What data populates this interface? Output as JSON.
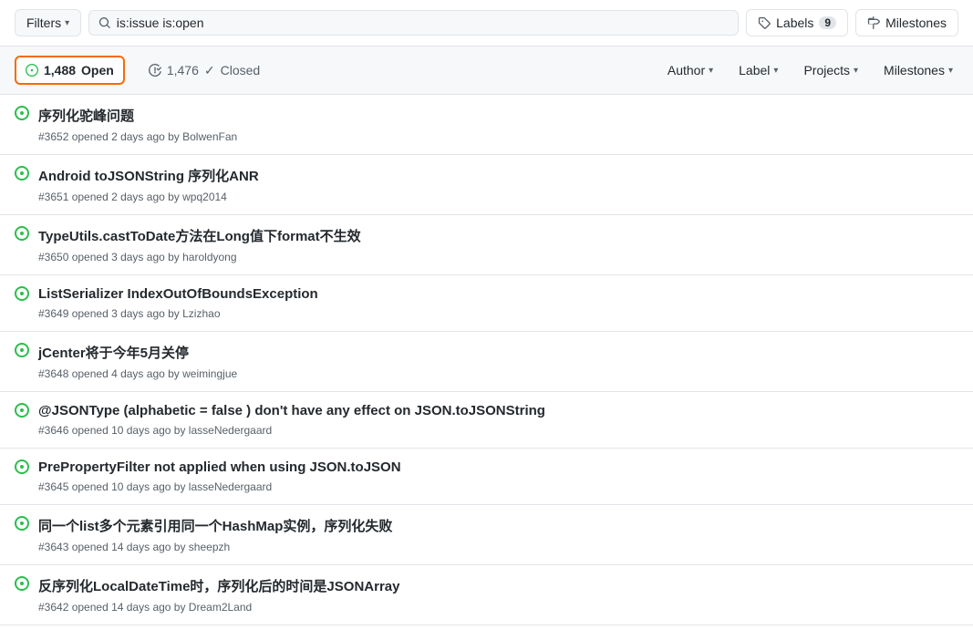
{
  "toolbar": {
    "filters_label": "Filters",
    "search_value": "is:issue is:open",
    "labels_label": "Labels",
    "labels_count": "9",
    "milestones_label": "Milestones"
  },
  "issues_header": {
    "open_count": "1,488",
    "open_label": "Open",
    "closed_count": "1,476",
    "closed_label": "Closed",
    "author_label": "Author",
    "label_label": "Label",
    "projects_label": "Projects",
    "milestones_label": "Milestones"
  },
  "issues": [
    {
      "id": "3652",
      "title": "序列化驼峰问题",
      "meta": "#3652 opened 2 days ago by BolwenFan"
    },
    {
      "id": "3651",
      "title": "Android toJSONString 序列化ANR",
      "meta": "#3651 opened 2 days ago by wpq2014"
    },
    {
      "id": "3650",
      "title": "TypeUtils.castToDate方法在Long值下format不生效",
      "meta": "#3650 opened 3 days ago by haroldyong"
    },
    {
      "id": "3649",
      "title": "ListSerializer IndexOutOfBoundsException",
      "meta": "#3649 opened 3 days ago by Lzizhao"
    },
    {
      "id": "3648",
      "title": "jCenter将于今年5月关停",
      "meta": "#3648 opened 4 days ago by weimingjue"
    },
    {
      "id": "3646",
      "title": "@JSONType (alphabetic = false ) don't have any effect on JSON.toJSONString",
      "meta": "#3646 opened 10 days ago by lasseNedergaard"
    },
    {
      "id": "3645",
      "title": "PrePropertyFilter not applied when using JSON.toJSON",
      "meta": "#3645 opened 10 days ago by lasseNedergaard"
    },
    {
      "id": "3643",
      "title": "同一个list多个元素引用同一个HashMap实例，序列化失败",
      "meta": "#3643 opened 14 days ago by sheepzh"
    },
    {
      "id": "3642",
      "title": "反序列化LocalDateTime时，序列化后的时间是JSONArray",
      "meta": "#3642 opened 14 days ago by Dream2Land"
    }
  ]
}
